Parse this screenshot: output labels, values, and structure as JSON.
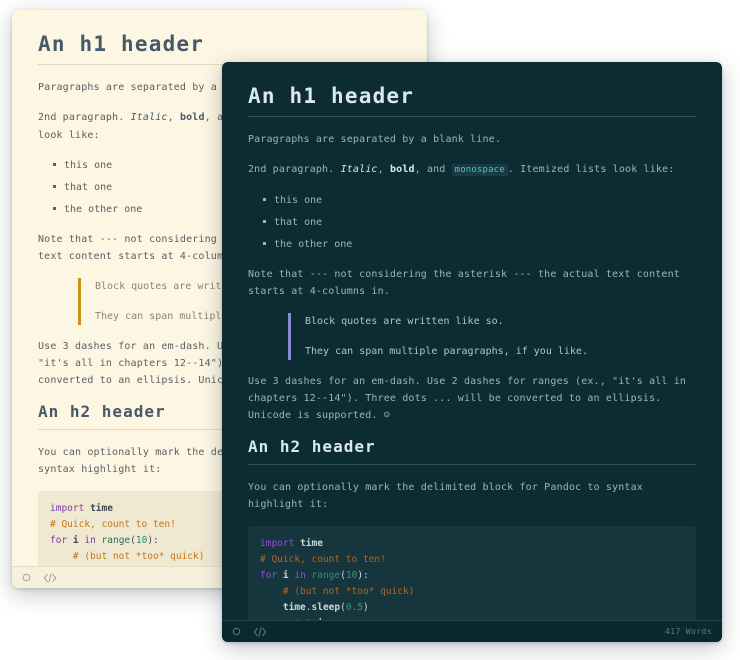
{
  "app": {
    "kind": "markdown-preview",
    "panels": [
      {
        "theme": "light",
        "colors": {
          "background": "#fdf6e3",
          "text": "#5a5f63",
          "heading": "#46596b",
          "rule": "#e2dabd",
          "blockquote_border": "#c8930e",
          "inline_code_text": "#d64c3b",
          "inline_code_bg": "#f6e3d8",
          "code_block_bg": "#efe9d2",
          "statusbar_bg": "#f7f0dc",
          "statusbar_text": "#a8a188"
        },
        "statusbar": {
          "circle_icon": "circle-icon",
          "code_icon": "code-brackets-icon",
          "word_count": ""
        }
      },
      {
        "theme": "dark",
        "colors": {
          "background": "#0d2b33",
          "text": "#9fb3b6",
          "heading": "#dbe7ea",
          "rule": "#2e4e55",
          "blockquote_border": "#8b8ad6",
          "inline_code_text": "#4ec9b0",
          "inline_code_bg": "#173c44",
          "code_block_bg": "#16353d",
          "statusbar_bg": "#0b2830",
          "statusbar_text": "#5d7e83"
        },
        "statusbar": {
          "circle_icon": "circle-icon",
          "code_icon": "code-brackets-icon",
          "word_count": "417 Words"
        }
      }
    ]
  },
  "document": {
    "h1": "An h1 header",
    "para1": "Paragraphs are separated by a blank line.",
    "para2": {
      "lead": "2nd paragraph. ",
      "italic": "Italic",
      "after_italic": ", ",
      "bold": "bold",
      "after_bold": ", and ",
      "code": "monospace",
      "tail": ". Itemized lists look like:"
    },
    "list": [
      "this one",
      "that one",
      "the other one"
    ],
    "para3": "Note that --- not considering the asterisk --- the actual text content starts at 4-columns in.",
    "blockquote": [
      "Block quotes are written like so.",
      "They can span multiple paragraphs, if you like."
    ],
    "para4": "Use 3 dashes for an em-dash. Use 2 dashes for ranges (ex., \"it's all in chapters 12--14\"). Three dots ... will be converted to an ellipsis. Unicode is supported. ☺",
    "h2": "An h2 header",
    "para5": "You can optionally mark the delimited block for Pandoc to syntax highlight it:",
    "code_block": {
      "language": "python",
      "lines": [
        [
          {
            "t": "import",
            "c": "k"
          },
          {
            "t": " ",
            "c": "tx"
          },
          {
            "t": "time",
            "c": "fn"
          }
        ],
        [
          {
            "t": "# Quick, count to ten!",
            "c": "cm"
          }
        ],
        [
          {
            "t": "for",
            "c": "k"
          },
          {
            "t": " i ",
            "c": "fn"
          },
          {
            "t": "in",
            "c": "k"
          },
          {
            "t": " ",
            "c": "tx"
          },
          {
            "t": "range",
            "c": "nb"
          },
          {
            "t": "(",
            "c": "tx"
          },
          {
            "t": "10",
            "c": "no"
          },
          {
            "t": "):",
            "c": "tx"
          }
        ],
        [
          {
            "t": "    # (but not *too* quick)",
            "c": "cm"
          }
        ],
        [
          {
            "t": "    ",
            "c": "tx"
          },
          {
            "t": "time",
            "c": "fn"
          },
          {
            "t": ".",
            "c": "tx"
          },
          {
            "t": "sleep",
            "c": "fn"
          },
          {
            "t": "(",
            "c": "tx"
          },
          {
            "t": "0.5",
            "c": "no"
          },
          {
            "t": ")",
            "c": "tx"
          }
        ],
        [
          {
            "t": "    ",
            "c": "tx"
          },
          {
            "t": "print",
            "c": "k"
          },
          {
            "t": " i",
            "c": "fn"
          }
        ]
      ]
    }
  }
}
